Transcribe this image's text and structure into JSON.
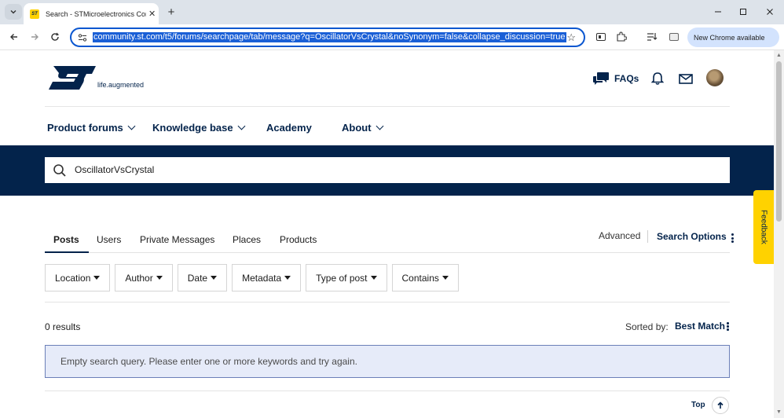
{
  "browser": {
    "tab_title": "Search - STMicroelectronics Community",
    "favicon_text": "ST",
    "url": "community.st.com/t5/forums/searchpage/tab/message?q=OscillatorVsCrystal&noSynonym=false&collapse_discussion=true",
    "update_button": "New Chrome available",
    "accent_color": "#0b57d0"
  },
  "header": {
    "tagline": "life.augmented",
    "faqs_label": "FAQs"
  },
  "nav": {
    "items": [
      {
        "label": "Product forums",
        "has_dropdown": true
      },
      {
        "label": "Knowledge base",
        "has_dropdown": true
      },
      {
        "label": "Academy",
        "has_dropdown": false
      },
      {
        "label": "About",
        "has_dropdown": true
      }
    ]
  },
  "search": {
    "query": "OscillatorVsCrystal",
    "band_color": "#03234b"
  },
  "results": {
    "tabs": [
      "Posts",
      "Users",
      "Private Messages",
      "Places",
      "Products"
    ],
    "active_tab": "Posts",
    "advanced_label": "Advanced",
    "search_options_label": "Search Options",
    "filters": [
      "Location",
      "Author",
      "Date",
      "Metadata",
      "Type of post",
      "Contains"
    ],
    "count_text": "0 results",
    "sorted_by_label": "Sorted by:",
    "sort_value": "Best Match",
    "empty_message": "Empty search query. Please enter one or more keywords and try again."
  },
  "feedback_label": "Feedback",
  "top_label": "Top"
}
